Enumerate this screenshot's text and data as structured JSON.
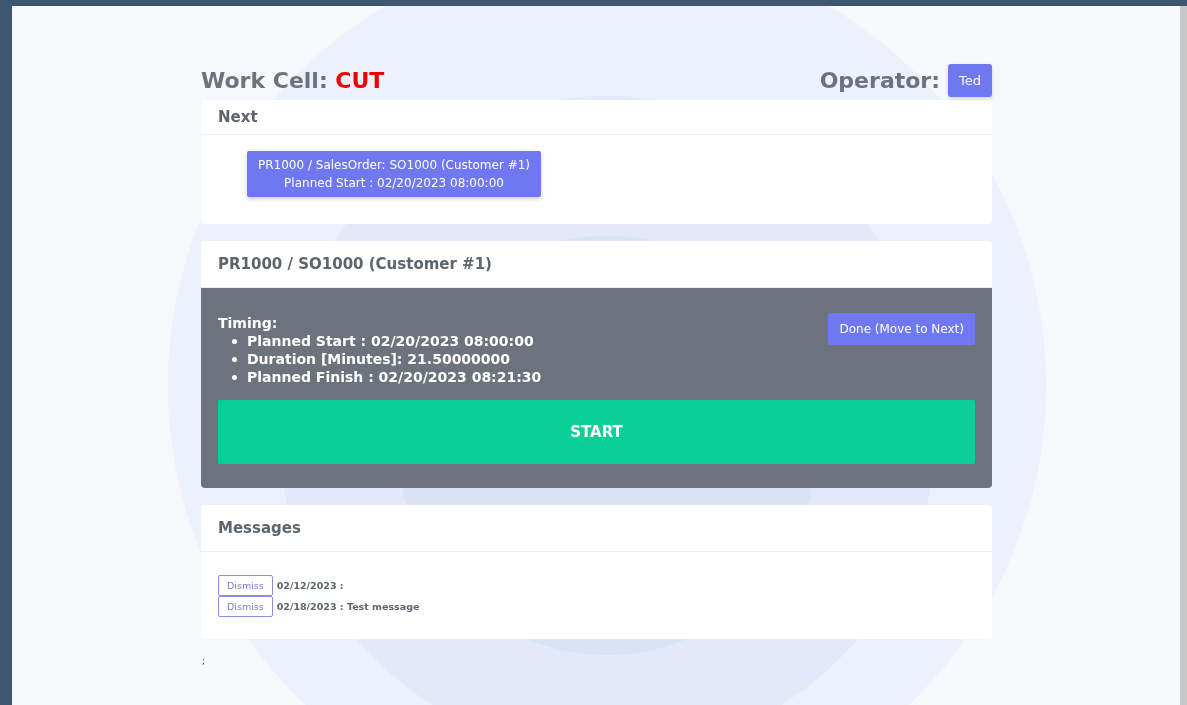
{
  "header": {
    "label": "Work Cell:",
    "cell": "CUT",
    "operator_label": "Operator:",
    "operator": "Ted"
  },
  "next": {
    "title": "Next",
    "items": [
      {
        "line1": "PR1000 / SalesOrder: SO1000 (Customer #1)",
        "line2": "Planned Start : 02/20/2023 08:00:00"
      }
    ]
  },
  "job": {
    "title": "PR1000 / SO1000 (Customer #1)",
    "timing_label": "Timing:",
    "timing": [
      "Planned Start : 02/20/2023 08:00:00",
      "Duration [Minutes]: 21.50000000",
      "Planned Finish : 02/20/2023 08:21:30"
    ],
    "done_button": "Done (Move to Next)",
    "start_button": "START"
  },
  "messages": {
    "title": "Messages",
    "items": [
      {
        "button": "Dismiss",
        "text": "02/12/2023 :"
      },
      {
        "button": "Dismiss",
        "text": "02/18/2023 : Test message"
      }
    ]
  },
  "footer": ";"
}
